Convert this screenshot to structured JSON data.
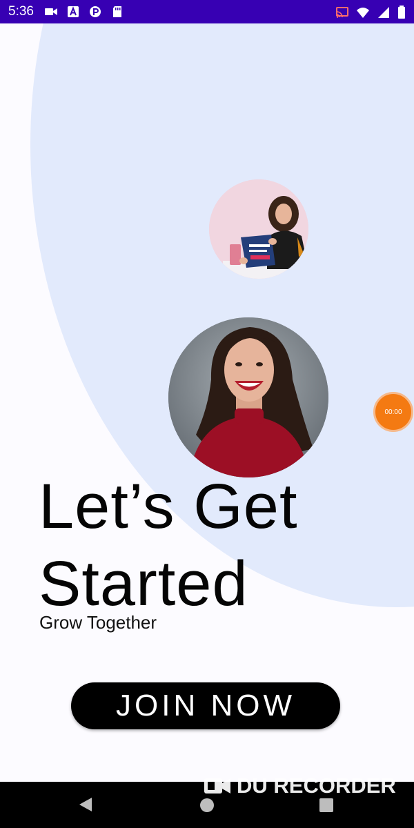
{
  "status_bar": {
    "time": "5:36",
    "left_icons": [
      "video-camera-icon",
      "text-a-icon",
      "app-p-icon",
      "sd-card-icon"
    ],
    "right_icons": [
      "cast-icon",
      "wifi-icon",
      "signal-icon",
      "battery-icon"
    ]
  },
  "main": {
    "headline_line1": "Let’s Get",
    "headline_line2": "Started",
    "subtitle": "Grow Together",
    "join_button_label": "JOIN NOW"
  },
  "recorder": {
    "timer": "00:00",
    "watermark": "DU RECORDER"
  },
  "nav_bar": {
    "buttons": [
      "back",
      "home",
      "recents"
    ]
  },
  "colors": {
    "status_bar": "#3700b3",
    "background_blob": "#e2eafc",
    "button": "#000000",
    "recorder_bubble": "#f47a12"
  }
}
